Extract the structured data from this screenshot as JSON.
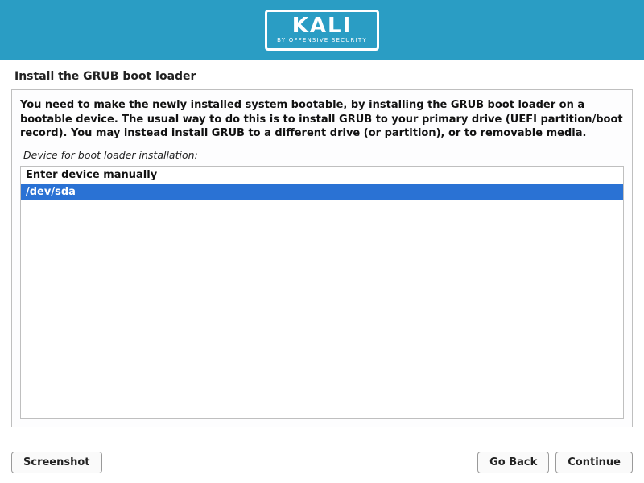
{
  "header": {
    "brand_top": "KALI",
    "brand_sub": "BY OFFENSIVE SECURITY"
  },
  "page": {
    "title": "Install the GRUB boot loader",
    "instruction": "You need to make the newly installed system bootable, by installing the GRUB boot loader on a bootable device. The usual way to do this is to install GRUB to your primary drive (UEFI partition/boot record). You may instead install GRUB to a different drive (or partition), or to removable media.",
    "device_prompt": "Device for boot loader installation:"
  },
  "devices": {
    "options": [
      {
        "label": "Enter device manually",
        "selected": false
      },
      {
        "label": "/dev/sda",
        "selected": true
      }
    ]
  },
  "buttons": {
    "screenshot": "Screenshot",
    "go_back": "Go Back",
    "continue": "Continue"
  }
}
